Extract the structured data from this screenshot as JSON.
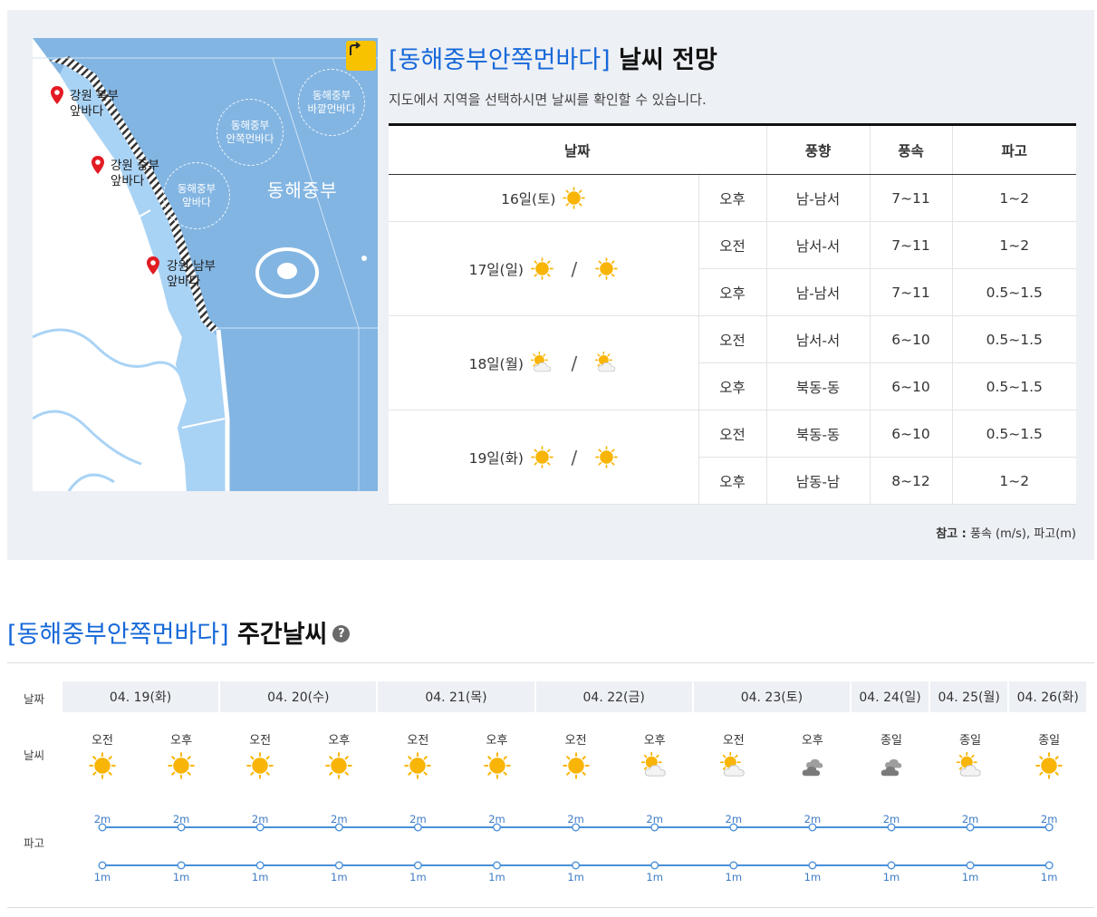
{
  "map": {
    "sea_name": "동해중부",
    "labels": [
      {
        "line1": "강원 북부",
        "line2": "앞바다"
      },
      {
        "line1": "강원 중부",
        "line2": "앞바다"
      },
      {
        "line1": "강원 남부",
        "line2": "앞바다"
      }
    ],
    "zones": [
      {
        "line1": "동해중부",
        "line2": "바깥먼바다"
      },
      {
        "line1": "동해중부",
        "line2": "안쪽먼바다"
      },
      {
        "line1": "동해중부",
        "line2": "앞바다"
      }
    ],
    "refresh_icon": "refresh-icon"
  },
  "forecast": {
    "title_bracket": "[동해중부안쪽먼바다]",
    "title_rest": " 날씨 전망",
    "description": "지도에서 지역을 선택하시면 날씨를 확인할 수 있습니다.",
    "headers": [
      "날짜",
      "풍향",
      "풍속",
      "파고"
    ],
    "slash": "/",
    "days": [
      {
        "date": "16일(토)",
        "icons": [
          "sunny"
        ],
        "rows": [
          {
            "period": "오후",
            "wind_dir": "남-남서",
            "wind_speed": "7~11",
            "wave": "1~2"
          }
        ]
      },
      {
        "date": "17일(일)",
        "icons": [
          "sunny",
          "sunny"
        ],
        "rows": [
          {
            "period": "오전",
            "wind_dir": "남서-서",
            "wind_speed": "7~11",
            "wave": "1~2"
          },
          {
            "period": "오후",
            "wind_dir": "남-남서",
            "wind_speed": "7~11",
            "wave": "0.5~1.5"
          }
        ]
      },
      {
        "date": "18일(월)",
        "icons": [
          "partly-cloudy",
          "partly-cloudy"
        ],
        "rows": [
          {
            "period": "오전",
            "wind_dir": "남서-서",
            "wind_speed": "6~10",
            "wave": "0.5~1.5"
          },
          {
            "period": "오후",
            "wind_dir": "북동-동",
            "wind_speed": "6~10",
            "wave": "0.5~1.5"
          }
        ]
      },
      {
        "date": "19일(화)",
        "icons": [
          "sunny",
          "sunny"
        ],
        "rows": [
          {
            "period": "오전",
            "wind_dir": "북동-동",
            "wind_speed": "6~10",
            "wave": "0.5~1.5"
          },
          {
            "period": "오후",
            "wind_dir": "남동-남",
            "wind_speed": "8~12",
            "wave": "1~2"
          }
        ]
      }
    ],
    "note_label": "참고 :",
    "note_text": " 풍속 (m/s), 파고(m)"
  },
  "weekly": {
    "title_bracket": "[동해중부안쪽먼바다]",
    "title_rest": " 주간날씨",
    "help_icon": "?",
    "row_labels": {
      "date": "날짜",
      "weather": "날씨",
      "wave": "파고"
    },
    "days": [
      {
        "label": "04. 19(화)",
        "slots": 2
      },
      {
        "label": "04. 20(수)",
        "slots": 2
      },
      {
        "label": "04. 21(목)",
        "slots": 2
      },
      {
        "label": "04. 22(금)",
        "slots": 2
      },
      {
        "label": "04. 23(토)",
        "slots": 2
      },
      {
        "label": "04. 24(일)",
        "slots": 1
      },
      {
        "label": "04. 25(월)",
        "slots": 1
      },
      {
        "label": "04. 26(화)",
        "slots": 1
      }
    ],
    "slots": [
      {
        "period": "오전",
        "icon": "sunny",
        "wave_max": "2m",
        "wave_min": "1m"
      },
      {
        "period": "오후",
        "icon": "sunny",
        "wave_max": "2m",
        "wave_min": "1m"
      },
      {
        "period": "오전",
        "icon": "sunny",
        "wave_max": "2m",
        "wave_min": "1m"
      },
      {
        "period": "오후",
        "icon": "sunny",
        "wave_max": "2m",
        "wave_min": "1m"
      },
      {
        "period": "오전",
        "icon": "sunny",
        "wave_max": "2m",
        "wave_min": "1m"
      },
      {
        "period": "오후",
        "icon": "sunny",
        "wave_max": "2m",
        "wave_min": "1m"
      },
      {
        "period": "오전",
        "icon": "sunny",
        "wave_max": "2m",
        "wave_min": "1m"
      },
      {
        "period": "오후",
        "icon": "partly-cloudy",
        "wave_max": "2m",
        "wave_min": "1m"
      },
      {
        "period": "오전",
        "icon": "partly-cloudy",
        "wave_max": "2m",
        "wave_min": "1m"
      },
      {
        "period": "오후",
        "icon": "cloudy",
        "wave_max": "2m",
        "wave_min": "1m"
      },
      {
        "period": "종일",
        "icon": "cloudy",
        "wave_max": "2m",
        "wave_min": "1m"
      },
      {
        "period": "종일",
        "icon": "partly-cloudy",
        "wave_max": "2m",
        "wave_min": "1m"
      },
      {
        "period": "종일",
        "icon": "sunny",
        "wave_max": "2m",
        "wave_min": "1m"
      }
    ]
  },
  "colors": {
    "accent": "#1668d9",
    "sea": "#82b5e2",
    "coast_sea": "#a9d3f5",
    "sun": "#f9b507",
    "wave_line": "#4a90d9",
    "panel_bg": "#edf0f5"
  }
}
